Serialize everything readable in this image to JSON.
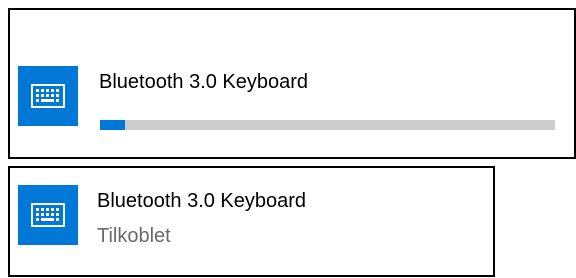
{
  "pairing_card": {
    "device_name": "Bluetooth 3.0 Keyboard",
    "device_icon": "keyboard-icon",
    "progress": 0.055
  },
  "connected_card": {
    "device_name": "Bluetooth 3.0 Keyboard",
    "device_icon": "keyboard-icon",
    "status": "Tilkoblet"
  },
  "colors": {
    "accent": "#0078d7",
    "progress_track": "#cccccc",
    "status_text": "#6b6b6b"
  }
}
